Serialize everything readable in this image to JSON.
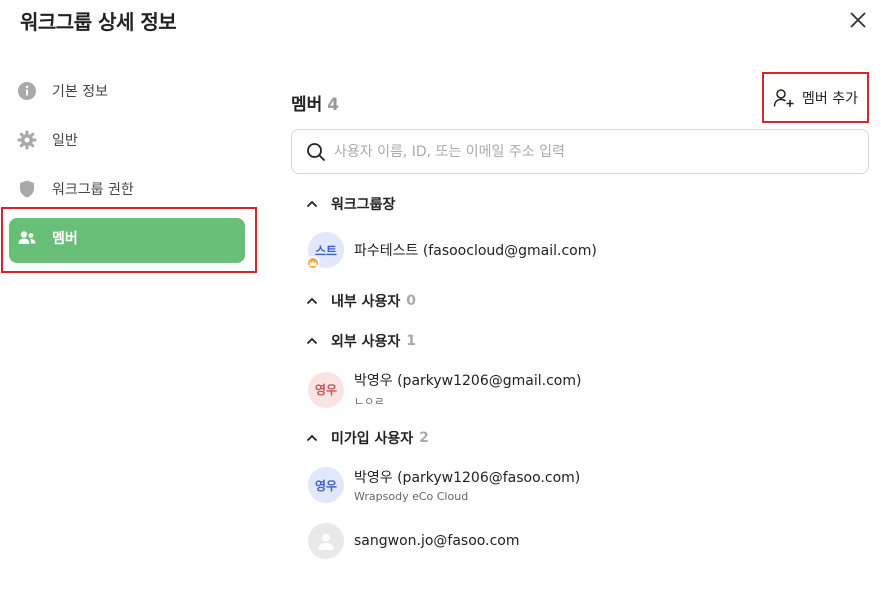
{
  "dialog": {
    "title": "워크그룹 상세 정보"
  },
  "sidebar": {
    "items": [
      {
        "label": "기본 정보",
        "icon": "info-icon"
      },
      {
        "label": "일반",
        "icon": "gear-icon"
      },
      {
        "label": "워크그룹 권한",
        "icon": "shield-icon"
      },
      {
        "label": "멤버",
        "icon": "members-icon",
        "active": true
      }
    ]
  },
  "members": {
    "title": "멤버",
    "count": "4",
    "add_label": "멤버 추가",
    "search_placeholder": "사용자 이름, ID, 또는 이메일 주소 입력",
    "groups": [
      {
        "label": "워크그룹장",
        "count": ""
      },
      {
        "label": "내부 사용자",
        "count": "0"
      },
      {
        "label": "외부 사용자",
        "count": "1"
      },
      {
        "label": "미가입 사용자",
        "count": "2"
      }
    ],
    "rows": [
      {
        "avatar": "스트",
        "name": "파수테스트 (fasoocloud@gmail.com)",
        "sub": ""
      },
      {
        "avatar": "영우",
        "name": "박영우 (parkyw1206@gmail.com)",
        "sub": "ㄴㅇㄹ"
      },
      {
        "avatar": "영우",
        "name": "박영우 (parkyw1206@fasoo.com)",
        "sub": "Wrapsody eCo Cloud"
      },
      {
        "avatar": "",
        "name": "sangwon.jo@fasoo.com",
        "sub": ""
      }
    ]
  },
  "colors": {
    "accent": "#68bf77",
    "highlight": "#d9232d"
  }
}
